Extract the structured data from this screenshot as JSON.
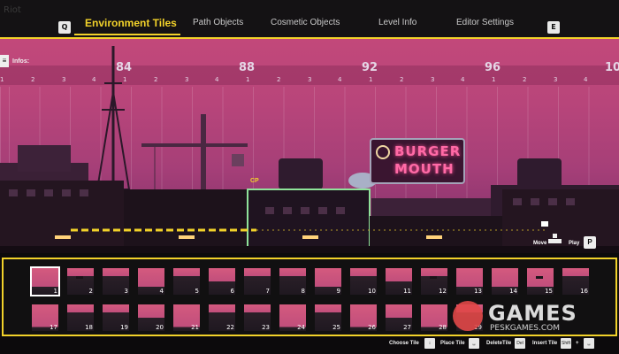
{
  "header": {
    "corner_text": "Riot",
    "left_key": "Q",
    "right_key": "E",
    "tabs": [
      {
        "label": "Environment Tiles",
        "active": true
      },
      {
        "label": "Path Objects",
        "active": false
      },
      {
        "label": "Cosmetic Objects",
        "active": false
      },
      {
        "label": "Level Info",
        "active": false
      },
      {
        "label": "Editor Settings",
        "active": false
      }
    ]
  },
  "scene": {
    "infos_label": "Infos:",
    "ruler_major": [
      "84",
      "88",
      "92",
      "96",
      "10"
    ],
    "ruler_minor": [
      "1",
      "2",
      "3",
      "4"
    ],
    "checkpoint_label": "CP",
    "sign_line1": "BURGER",
    "sign_line2": "MOUTH",
    "move_label": "Move",
    "play_label": "Play",
    "play_key": "P"
  },
  "palette": {
    "tiles": [
      {
        "number": "1"
      },
      {
        "number": "2"
      },
      {
        "number": "3"
      },
      {
        "number": "4"
      },
      {
        "number": "5"
      },
      {
        "number": "6"
      },
      {
        "number": "7"
      },
      {
        "number": "8"
      },
      {
        "number": "9"
      },
      {
        "number": "10"
      },
      {
        "number": "11"
      },
      {
        "number": "12"
      },
      {
        "number": "13"
      },
      {
        "number": "14"
      },
      {
        "number": "15"
      },
      {
        "number": "16"
      },
      {
        "number": "17"
      },
      {
        "number": "18"
      },
      {
        "number": "19"
      },
      {
        "number": "20"
      },
      {
        "number": "21"
      },
      {
        "number": "22"
      },
      {
        "number": "23"
      },
      {
        "number": "24"
      },
      {
        "number": "25"
      },
      {
        "number": "26"
      },
      {
        "number": "27"
      },
      {
        "number": "28"
      },
      {
        "number": "29"
      }
    ],
    "selected_tile": "1"
  },
  "footer": {
    "choose_tile": "Choose Tile",
    "place_tile": "Place Tile",
    "delete_tile": "DeleteTile",
    "delete_key": "Del",
    "insert_tile": "Insert Tile",
    "insert_key": "Shift"
  },
  "watermark": {
    "title": "GAMES",
    "subtitle": "PESKGAMES.COM"
  },
  "colors": {
    "accent": "#f2d22a",
    "sky": "#c2487a",
    "neon_pink": "#ff6aa6"
  }
}
